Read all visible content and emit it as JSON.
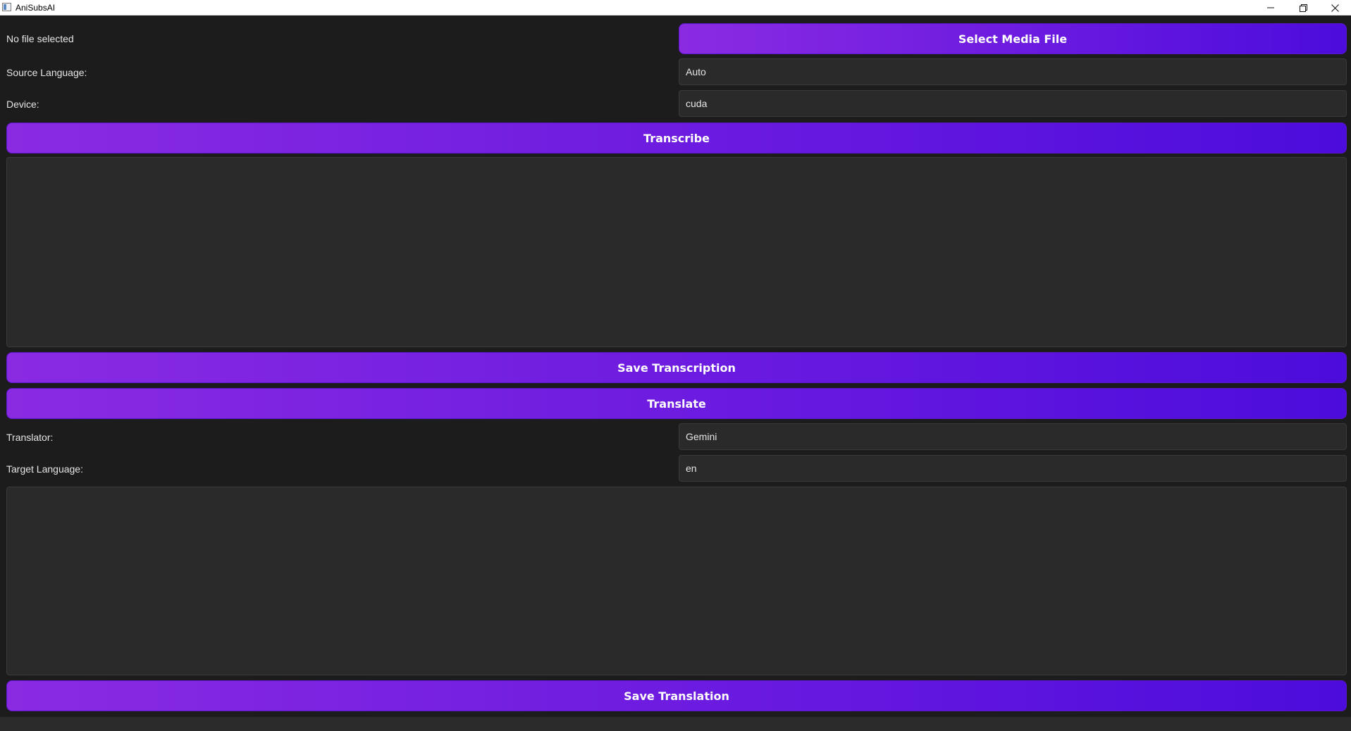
{
  "window": {
    "title": "AniSubsAI",
    "minimize_glyph": "—",
    "close_glyph": "✕"
  },
  "media": {
    "file_status": "No file selected",
    "select_button": "Select Media File"
  },
  "source_language": {
    "label": "Source Language:",
    "value": "Auto"
  },
  "device": {
    "label": "Device:",
    "value": "cuda"
  },
  "transcription": {
    "transcribe_button": "Transcribe",
    "text": "",
    "save_button": "Save Transcription"
  },
  "translation": {
    "translate_button": "Translate",
    "translator_label": "Translator:",
    "translator_value": "Gemini",
    "target_label": "Target Language:",
    "target_value": "en",
    "text": "",
    "save_button": "Save Translation"
  },
  "colors": {
    "background": "#1c1c1c",
    "field": "#2a2a2a",
    "button_gradient_start": "#8a2be2",
    "button_gradient_end": "#4c0cdc",
    "text": "#e6e6e6"
  }
}
